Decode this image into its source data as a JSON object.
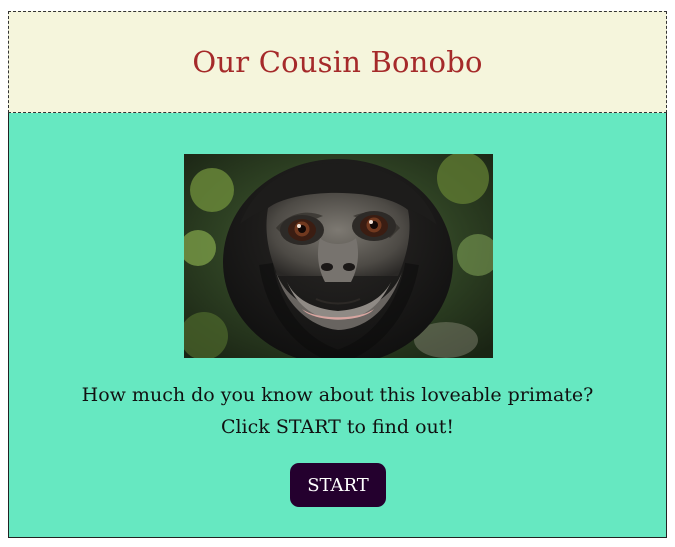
{
  "header": {
    "title": "Our Cousin Bonobo"
  },
  "main": {
    "image_icon": "bonobo-photo",
    "intro_line1": "How much do you know about this loveable primate?",
    "intro_line2": "Click START to find out!",
    "start_label": "START"
  },
  "colors": {
    "header_bg": "#f5f5dc",
    "title_color": "#a52a2a",
    "main_bg": "#66e8c1",
    "button_bg": "#24002e",
    "button_text": "#ffffff"
  }
}
